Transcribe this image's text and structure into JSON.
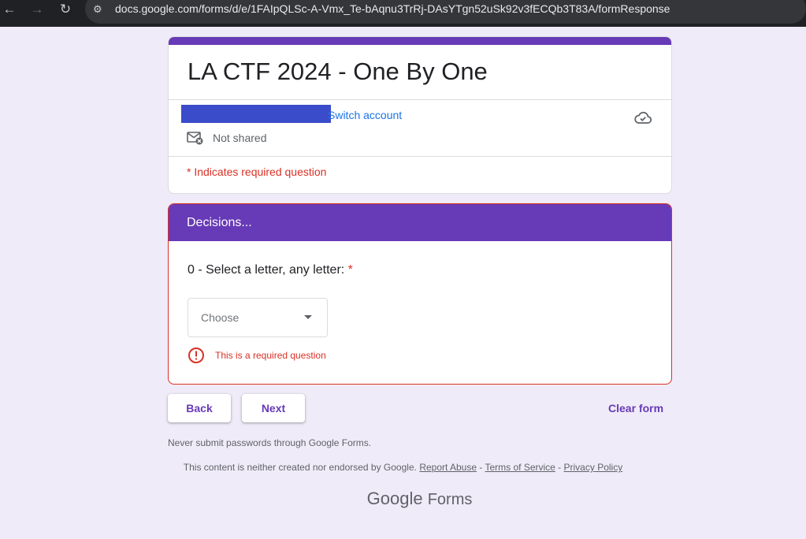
{
  "browser": {
    "url": "docs.google.com/forms/d/e/1FAIpQLSc-A-Vmx_Te-bAqnu3TrRj-DAsYTgn52uSk92v3fECQb3T83A/formResponse",
    "back_icon": "←",
    "forward_icon": "→",
    "reload_icon": "↻",
    "site_info_icon": "⚙"
  },
  "form": {
    "title": "LA CTF 2024 - One By One",
    "switch_account": "Switch account",
    "not_shared": "Not shared",
    "required_note": "* Indicates required question",
    "accent_color": "#673ab7",
    "error_color": "#d93025"
  },
  "section": {
    "title": "Decisions...",
    "question": "0 - Select a letter, any letter:",
    "required_star": "*",
    "dropdown_value": "Choose",
    "error": "This is a required question"
  },
  "actions": {
    "back": "Back",
    "next": "Next",
    "clear": "Clear form"
  },
  "footer": {
    "note": "Never submit passwords through Google Forms.",
    "legal_text": "This content is neither created nor endorsed by Google.",
    "report_abuse": "Report Abuse",
    "sep1": " - ",
    "terms": "Terms of Service",
    "sep2": " - ",
    "privacy": "Privacy Policy",
    "brand_google": "Google",
    "brand_forms": "Forms"
  }
}
